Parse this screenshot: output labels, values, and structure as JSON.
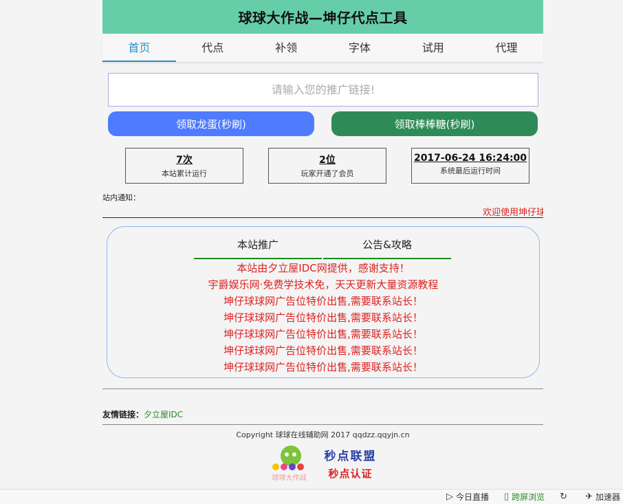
{
  "header": {
    "title": "球球大作战—坤仔代点工具"
  },
  "tabs": [
    {
      "label": "首页"
    },
    {
      "label": "代点"
    },
    {
      "label": "补领"
    },
    {
      "label": "字体"
    },
    {
      "label": "试用"
    },
    {
      "label": "代理"
    }
  ],
  "link_input": {
    "placeholder": "请输入您的推广链接!"
  },
  "buttons": {
    "egg": "领取龙蛋(秒刷)",
    "lollipop": "领取棒棒糖(秒刷)"
  },
  "stats": [
    {
      "value": "7次",
      "label": "本站累计运行"
    },
    {
      "value": "2位",
      "label": "玩家开通了会员"
    },
    {
      "value": "2017-06-24 16:24:00",
      "label": "系统最后运行时间"
    }
  ],
  "notice": {
    "label": "站内通知：",
    "marquee": "欢迎使用坤仔球"
  },
  "promo": {
    "tabs": [
      "本站推广",
      "公告&攻略"
    ],
    "lines": [
      "本站由夕立屋IDC网提供，感谢支持！",
      "宇爵娱乐网·免费学技术免，天天更新大量资源教程",
      "坤仔球球网广告位特价出售,需要联系站长！",
      "坤仔球球网广告位特价出售,需要联系站长！",
      "坤仔球球网广告位特价出售,需要联系站长！",
      "坤仔球球网广告位特价出售,需要联系站长！",
      "坤仔球球网广告位特价出售,需要联系站长！"
    ]
  },
  "friends": {
    "label": "友情链接：",
    "link": "夕立屋IDC"
  },
  "footer": {
    "copyright": "Copyright 球球在线辅助网 2017 qqdzz.qqyjn.cn",
    "mascot_text": "球球大作战",
    "league_title": "秒点联盟",
    "league_sub": "秒点认证"
  },
  "statusbar": {
    "items": [
      {
        "label": "今日直播",
        "icon": "play-circle-icon"
      },
      {
        "label": "跨屏浏览",
        "icon": "phone-icon"
      },
      {
        "label": "",
        "icon": "refresh-icon"
      },
      {
        "label": "加速器",
        "icon": "rocket-icon"
      }
    ]
  }
}
